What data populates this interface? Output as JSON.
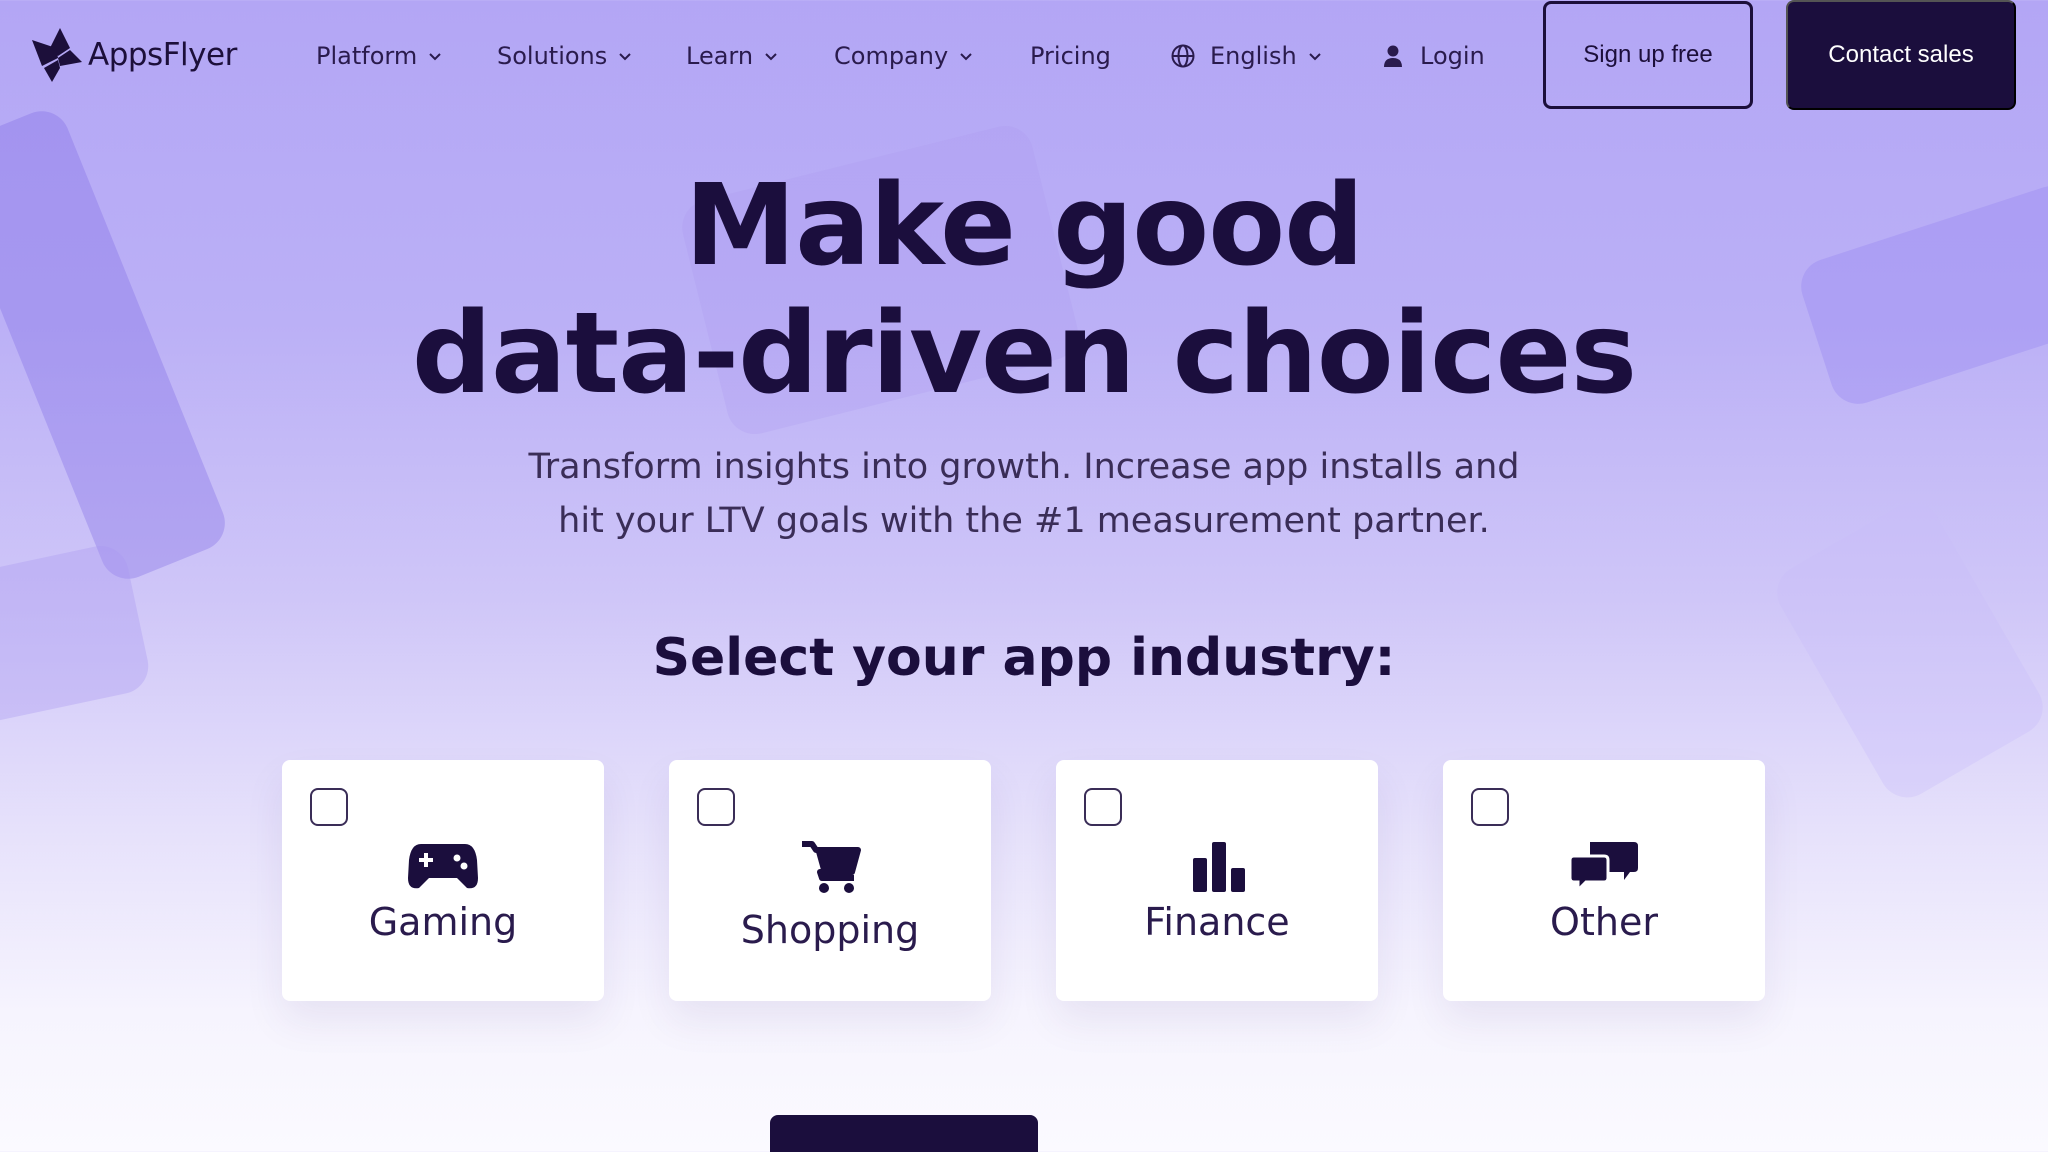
{
  "brand": {
    "name": "AppsFlyer"
  },
  "nav": {
    "platform": "Platform",
    "solutions": "Solutions",
    "learn": "Learn",
    "company": "Company",
    "pricing": "Pricing",
    "language": "English",
    "login": "Login",
    "signup": "Sign up free",
    "contact": "Contact sales"
  },
  "hero": {
    "title_line1": "Make good",
    "title_line2": "data-driven choices",
    "subtitle_line1": "Transform insights into growth. Increase app installs and",
    "subtitle_line2": "hit your LTV goals with the #1 measurement partner."
  },
  "industry": {
    "heading": "Select your app industry:",
    "options": [
      {
        "label": "Gaming",
        "icon": "gamepad-icon",
        "checked": false
      },
      {
        "label": "Shopping",
        "icon": "cart-icon",
        "checked": false
      },
      {
        "label": "Finance",
        "icon": "bar-chart-icon",
        "checked": false
      },
      {
        "label": "Other",
        "icon": "chat-bubbles-icon",
        "checked": false
      }
    ]
  },
  "colors": {
    "primary_dark": "#1b0e3d",
    "background_top": "#b3a6f5",
    "card": "#ffffff"
  }
}
